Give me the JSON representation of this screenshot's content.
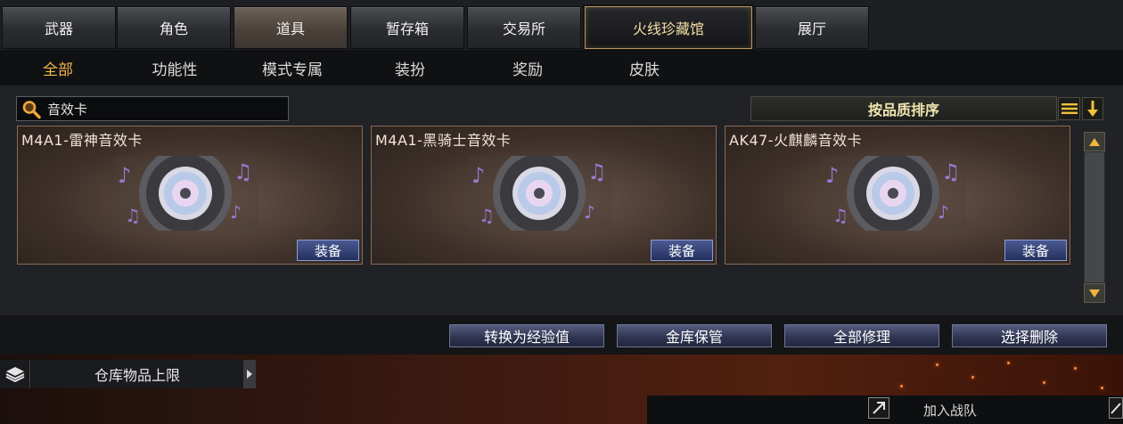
{
  "top_tabs": {
    "weapons": "武器",
    "character": "角色",
    "items": "道具",
    "storage_box": "暂存箱",
    "exchange": "交易所",
    "collection": "火线珍藏馆",
    "showroom": "展厅"
  },
  "sub_tabs": {
    "all": "全部",
    "functional": "功能性",
    "mode_exclusive": "模式专属",
    "dress_up": "装扮",
    "rewards": "奖励",
    "skins": "皮肤"
  },
  "search": {
    "value": "音效卡"
  },
  "sort": {
    "label": "按品质排序"
  },
  "cards": [
    {
      "title": "M4A1-雷神音效卡",
      "equip_label": "装备"
    },
    {
      "title": "M4A1-黑骑士音效卡",
      "equip_label": "装备"
    },
    {
      "title": "AK47-火麒麟音效卡",
      "equip_label": "装备"
    }
  ],
  "actions": {
    "convert_xp": "转换为经验值",
    "vault_storage": "金库保管",
    "repair_all": "全部修理",
    "select_delete": "选择删除"
  },
  "footer": {
    "storage_limit": "仓库物品上限",
    "join_team": "加入战队"
  },
  "colors": {
    "active_subtab": "#f2b54b",
    "special_tab_border": "#b79a5e",
    "equip_button": "#2e3a6e"
  }
}
